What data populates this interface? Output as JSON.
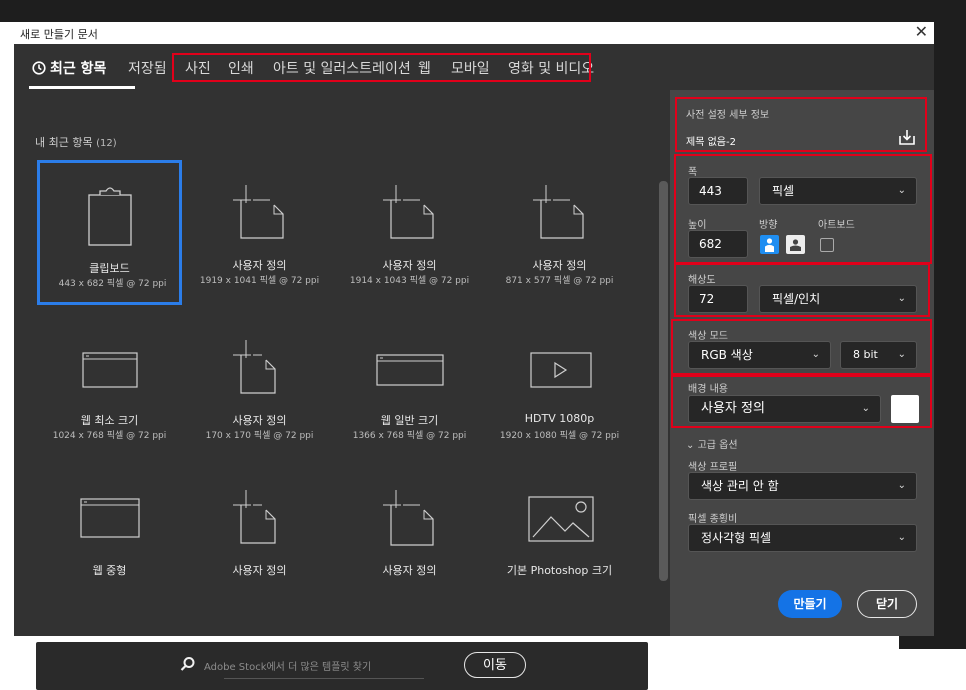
{
  "dialog": {
    "title": "새로 만들기 문서",
    "close_glyph": "✕"
  },
  "tabs": [
    {
      "label": "최근 항목",
      "icon": "clock-icon",
      "active": true
    },
    {
      "label": "저장됨"
    },
    {
      "label": "사진"
    },
    {
      "label": "인쇄"
    },
    {
      "label": "아트 및 일러스트레이션"
    },
    {
      "label": "웹"
    },
    {
      "label": "모바일"
    },
    {
      "label": "영화 및 비디오"
    }
  ],
  "recent": {
    "label": "내 최근 항목",
    "count": "(12)",
    "items": [
      {
        "name": "클립보드",
        "dims": "443 x 682 픽셀 @ 72 ppi",
        "icon": "clipboard-icon",
        "selected": true
      },
      {
        "name": "사용자 정의",
        "dims": "1919 x 1041 픽셀 @ 72 ppi",
        "icon": "custom-document-icon"
      },
      {
        "name": "사용자 정의",
        "dims": "1914 x 1043 픽셀 @ 72 ppi",
        "icon": "custom-document-icon"
      },
      {
        "name": "사용자 정의",
        "dims": "871 x 577 픽셀 @ 72 ppi",
        "icon": "custom-document-icon"
      },
      {
        "name": "웹 최소 크기",
        "dims": "1024 x 768 픽셀 @ 72 ppi",
        "icon": "web-window-icon"
      },
      {
        "name": "사용자 정의",
        "dims": "170 x 170 픽셀 @ 72 ppi",
        "icon": "custom-document-icon"
      },
      {
        "name": "웹 일반 크기",
        "dims": "1366 x 768 픽셀 @ 72 ppi",
        "icon": "web-window-icon"
      },
      {
        "name": "HDTV 1080p",
        "dims": "1920 x 1080 픽셀 @ 72 ppi",
        "icon": "video-play-icon"
      },
      {
        "name": "웹 중형",
        "dims": "",
        "icon": "web-window-icon"
      },
      {
        "name": "사용자 정의",
        "dims": "",
        "icon": "custom-document-icon"
      },
      {
        "name": "사용자 정의",
        "dims": "",
        "icon": "custom-document-icon"
      },
      {
        "name": "기본 Photoshop 크기",
        "dims": "",
        "icon": "landscape-image-icon"
      }
    ]
  },
  "search": {
    "placeholder": "Adobe Stock에서 더 많은 템플릿 찾기",
    "go_label": "이동",
    "icon": "search-icon"
  },
  "preset": {
    "header": "사전 설정 세부 정보",
    "name": "제목 없음-2",
    "save_icon": "save-preset-icon"
  },
  "width": {
    "label": "폭",
    "value": "443",
    "unit": "픽셀"
  },
  "height": {
    "label": "높이",
    "value": "682"
  },
  "orientation": {
    "label": "방향",
    "portrait_icon": "portrait-icon",
    "landscape_icon": "landscape-icon"
  },
  "artboard": {
    "label": "아트보드",
    "checked": false
  },
  "resolution": {
    "label": "해상도",
    "value": "72",
    "unit": "픽셀/인치"
  },
  "color_mode": {
    "label": "색상 모드",
    "value": "RGB 색상",
    "bits": "8 bit"
  },
  "background": {
    "label": "배경 내용",
    "value": "사용자 정의",
    "swatch": "#ffffff"
  },
  "advanced": {
    "label": "고급 옵션",
    "profile_label": "색상 프로필",
    "profile_value": "색상 관리 안 함",
    "pixel_ratio_label": "픽셀 종횡비",
    "pixel_ratio_value": "정사각형 픽셀"
  },
  "buttons": {
    "create": "만들기",
    "close": "닫기"
  },
  "colors": {
    "accent": "#1473e6",
    "selection": "#2b7de9",
    "highlight_box": "#e1001a"
  }
}
